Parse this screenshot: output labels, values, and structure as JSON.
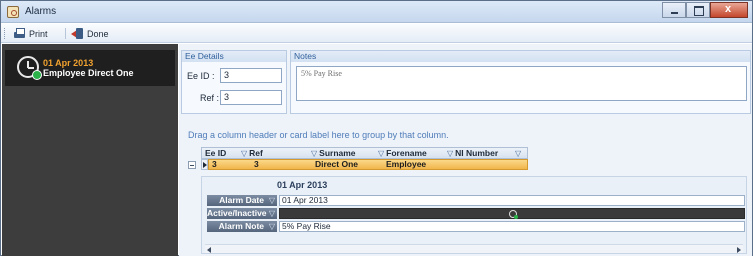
{
  "window": {
    "title": "Alarms"
  },
  "toolbar": {
    "print_label": "Print",
    "done_label": "Done"
  },
  "left_list": {
    "items": [
      {
        "date": "01 Apr 2013",
        "name": "Employee Direct One"
      }
    ]
  },
  "ee_details": {
    "header": "Ee Details",
    "ee_id_label": "Ee ID :",
    "ee_id_value": "3",
    "ref_label": "Ref :",
    "ref_value": "3"
  },
  "notes": {
    "header": "Notes",
    "text": "5% Pay Rise"
  },
  "grid": {
    "group_hint": "Drag a column header or card label here to group by that column.",
    "columns": [
      "Ee ID",
      "Ref",
      "Surname",
      "Forename",
      "NI Number"
    ],
    "rows": [
      {
        "ee_id": "3",
        "ref": "3",
        "surname": "Direct One",
        "forename": "Employee",
        "ni_number": ""
      }
    ]
  },
  "card": {
    "title": "01 Apr 2013",
    "fields": [
      {
        "label": "Alarm Date",
        "value": "01 Apr 2013"
      },
      {
        "label": "Active/Inactive :",
        "value": ""
      },
      {
        "label": "Alarm Note",
        "value": "5% Pay Rise"
      }
    ]
  },
  "icons": {
    "app": "alarm-app-icon",
    "print": "printer-icon",
    "done": "exit-door-icon",
    "alarm": "alarm-clock-icon",
    "filter": "filter-icon"
  },
  "colors": {
    "accent_orange": "#f1a22f",
    "selected_row": "#f2b54b",
    "left_pane_bg": "#3d3d3d",
    "group_header_text": "#2f5f9c"
  }
}
